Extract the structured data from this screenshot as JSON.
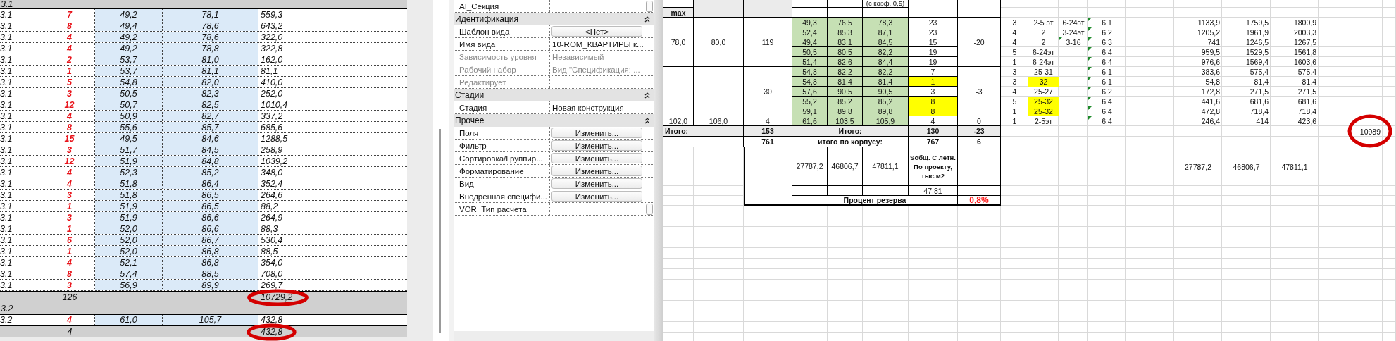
{
  "schedule": {
    "groups": [
      {
        "header": "3.1",
        "count": "126",
        "total": "10729,2",
        "circled": true,
        "rows": [
          [
            "3.1",
            "7",
            "49,2",
            "78,1",
            "559,3"
          ],
          [
            "3.1",
            "8",
            "49,4",
            "78,6",
            "643,2"
          ],
          [
            "3.1",
            "4",
            "49,2",
            "78,6",
            "322,0"
          ],
          [
            "3.1",
            "4",
            "49,2",
            "78,8",
            "322,8"
          ],
          [
            "3.1",
            "2",
            "53,7",
            "81,0",
            "162,0"
          ],
          [
            "3.1",
            "1",
            "53,7",
            "81,1",
            "81,1"
          ],
          [
            "3.1",
            "5",
            "54,8",
            "82,0",
            "410,0"
          ],
          [
            "3.1",
            "3",
            "50,5",
            "82,3",
            "252,0"
          ],
          [
            "3.1",
            "12",
            "50,7",
            "82,5",
            "1010,4"
          ],
          [
            "3.1",
            "4",
            "50,9",
            "82,7",
            "337,2"
          ],
          [
            "3.1",
            "8",
            "55,6",
            "85,7",
            "685,6"
          ],
          [
            "3.1",
            "15",
            "49,5",
            "84,6",
            "1288,5"
          ],
          [
            "3.1",
            "3",
            "51,7",
            "84,5",
            "258,9"
          ],
          [
            "3.1",
            "12",
            "51,9",
            "84,8",
            "1039,2"
          ],
          [
            "3.1",
            "4",
            "52,3",
            "85,2",
            "348,0"
          ],
          [
            "3.1",
            "4",
            "51,8",
            "86,4",
            "352,4"
          ],
          [
            "3.1",
            "3",
            "51,8",
            "86,5",
            "264,6"
          ],
          [
            "3.1",
            "1",
            "51,9",
            "86,5",
            "88,2"
          ],
          [
            "3.1",
            "3",
            "51,9",
            "86,6",
            "264,9"
          ],
          [
            "3.1",
            "1",
            "52,0",
            "86,6",
            "88,3"
          ],
          [
            "3.1",
            "6",
            "52,0",
            "86,7",
            "530,4"
          ],
          [
            "3.1",
            "1",
            "52,0",
            "86,8",
            "88,5"
          ],
          [
            "3.1",
            "4",
            "52,1",
            "86,8",
            "354,0"
          ],
          [
            "3.1",
            "8",
            "57,4",
            "88,5",
            "708,0"
          ],
          [
            "3.1",
            "3",
            "56,9",
            "89,9",
            "269,7"
          ]
        ]
      },
      {
        "header": "3.2",
        "count": "4",
        "total": "432,8",
        "circled": true,
        "rows": [
          [
            "3.2",
            "4",
            "61,0",
            "105,7",
            "432,8"
          ]
        ]
      }
    ]
  },
  "properties": {
    "top_rows": [
      {
        "label": "AI_Секция",
        "kind": "box",
        "disabled": false
      }
    ],
    "sections": [
      {
        "title": "Идентификация",
        "expanded": true,
        "rows": [
          {
            "label": "Шаблон вида",
            "kind": "button",
            "value": "<Нет>",
            "disabled": false
          },
          {
            "label": "Имя вида",
            "kind": "text",
            "value": "10-ROM_КВАРТИРЫ к...",
            "disabled": false
          },
          {
            "label": "Зависимость уровня",
            "kind": "text",
            "value": "Независимый",
            "disabled": true
          },
          {
            "label": "Рабочий набор",
            "kind": "text",
            "value": "Вид \"Спецификация: ...",
            "disabled": true
          },
          {
            "label": "Редактирует",
            "kind": "text",
            "disabled": true
          }
        ]
      },
      {
        "title": "Стадии",
        "expanded": true,
        "rows": [
          {
            "label": "Стадия",
            "kind": "text",
            "value": "Новая конструкция",
            "disabled": false
          }
        ]
      },
      {
        "title": "Прочее",
        "expanded": true,
        "rows": [
          {
            "label": "Поля",
            "kind": "button",
            "value": "Изменить...",
            "disabled": false
          },
          {
            "label": "Фильтр",
            "kind": "button",
            "value": "Изменить...",
            "disabled": false
          },
          {
            "label": "Сортировка/Группир...",
            "kind": "button",
            "value": "Изменить...",
            "disabled": false
          },
          {
            "label": "Форматирование",
            "kind": "button",
            "value": "Изменить...",
            "disabled": false
          },
          {
            "label": "Вид",
            "kind": "button",
            "value": "Изменить...",
            "disabled": false
          },
          {
            "label": "Внедренная специфи...",
            "kind": "button",
            "value": "Изменить...",
            "disabled": false
          },
          {
            "label": "VOR_Тип расчета",
            "kind": "box",
            "disabled": false
          }
        ]
      }
    ]
  },
  "sheet": {
    "header_fragment": "(с коэф. 0,5)",
    "max_label": "max",
    "groups": [
      {
        "column_2": "78,0",
        "column_3": "80,0",
        "column_4": "119",
        "column_9": "-20",
        "rows": [
          {
            "green": [
              "49,3",
              "76,5",
              "78,3"
            ],
            "count": "23",
            "count_highlight": false,
            "column_10": "3",
            "column_11": "2-5 эт",
            "column_11_highlight": false,
            "column_12": "6-24эт",
            "column_12_flag": false,
            "column_13": "6,1",
            "column_13_flag": true,
            "values": [
              "1133,9",
              "1759,5",
              "1800,9"
            ]
          },
          {
            "green": [
              "52,4",
              "85,3",
              "87,1"
            ],
            "count": "23",
            "count_highlight": false,
            "column_10": "4",
            "column_11": "2",
            "column_11_highlight": false,
            "column_12": "3-24эт",
            "column_12_flag": false,
            "column_13": "6,2",
            "column_13_flag": true,
            "values": [
              "1205,2",
              "1961,9",
              "2003,3"
            ]
          },
          {
            "green": [
              "49,4",
              "83,1",
              "84,5"
            ],
            "count": "15",
            "count_highlight": false,
            "column_10": "4",
            "column_11": "2",
            "column_11_highlight": false,
            "column_12": "3-16",
            "column_12_flag": true,
            "column_13": "6,3",
            "column_13_flag": true,
            "values": [
              "741",
              "1246,5",
              "1267,5"
            ]
          },
          {
            "green": [
              "50,5",
              "80,5",
              "82,2"
            ],
            "count": "19",
            "count_highlight": false,
            "column_10": "5",
            "column_11": "6-24эт",
            "column_11_highlight": false,
            "column_13": "6,4",
            "column_13_flag": true,
            "values": [
              "959,5",
              "1529,5",
              "1561,8"
            ]
          },
          {
            "green": [
              "51,4",
              "82,6",
              "84,4"
            ],
            "count": "19",
            "count_highlight": false,
            "column_10": "1",
            "column_11": "6-24эт",
            "column_11_highlight": false,
            "column_13": "6,4",
            "column_13_flag": true,
            "values": [
              "976,6",
              "1569,4",
              "1603,6"
            ]
          }
        ]
      },
      {
        "column_4": "30",
        "column_9": "-3",
        "rows": [
          {
            "green": [
              "54,8",
              "82,2",
              "82,2"
            ],
            "count": "7",
            "count_highlight": false,
            "column_10": "3",
            "column_11": "25-31",
            "column_11_highlight": false,
            "column_13": "6,1",
            "column_13_flag": true,
            "values": [
              "383,6",
              "575,4",
              "575,4"
            ]
          },
          {
            "green": [
              "54,8",
              "81,4",
              "81,4"
            ],
            "count": "1",
            "count_highlight": true,
            "column_10": "3",
            "column_11": "32",
            "column_11_highlight": true,
            "column_13": "6,1",
            "column_13_flag": true,
            "values": [
              "54,8",
              "81,4",
              "81,4"
            ]
          },
          {
            "green": [
              "57,6",
              "90,5",
              "90,5"
            ],
            "count": "3",
            "count_highlight": false,
            "column_10": "4",
            "column_11": "25-27",
            "column_11_highlight": false,
            "column_13": "6,2",
            "column_13_flag": true,
            "values": [
              "172,8",
              "271,5",
              "271,5"
            ]
          },
          {
            "green": [
              "55,2",
              "85,2",
              "85,2"
            ],
            "count": "8",
            "count_highlight": true,
            "column_10": "5",
            "column_11": "25-32",
            "column_11_highlight": true,
            "column_13": "6,4",
            "column_13_flag": true,
            "values": [
              "441,6",
              "681,6",
              "681,6"
            ]
          },
          {
            "green": [
              "59,1",
              "89,8",
              "89,8"
            ],
            "count": "8",
            "count_highlight": true,
            "column_10": "1",
            "column_11": "25-32",
            "column_11_highlight": true,
            "column_13": "6,4",
            "column_13_flag": true,
            "values": [
              "472,8",
              "718,4",
              "718,4"
            ]
          }
        ]
      },
      {
        "column_2": "102,0",
        "column_3": "106,0",
        "column_4": "4",
        "column_9": "0",
        "rows": [
          {
            "green": [
              "61,6",
              "103,5",
              "105,9"
            ],
            "count": "4",
            "count_highlight": false,
            "column_10": "1",
            "column_11": "2-5эт",
            "column_11_highlight": false,
            "column_13": "6,4",
            "column_13_flag": true,
            "values": [
              "246,4",
              "414",
              "423,6"
            ]
          }
        ]
      }
    ],
    "total": {
      "label": "Итого:",
      "column_4": "153",
      "label_2": "Итого:",
      "column_8": "130",
      "column_9": "-23",
      "column_18": "10989",
      "column_18_circled": true
    },
    "building_total": {
      "column_4": "761",
      "label": "итого по корпусу:",
      "column_8": "767",
      "column_9": "6"
    },
    "areas": {
      "values": [
        "27787,2",
        "46806,7",
        "47811,1"
      ],
      "note": "Sобщ. С летн. По проекту, тыс.м2",
      "side_values": [
        "27787,2",
        "46806,7",
        "47811,1"
      ]
    },
    "area_project": "47,81",
    "reserve": {
      "label": "Процент резерва",
      "value": "0,8%"
    }
  }
}
